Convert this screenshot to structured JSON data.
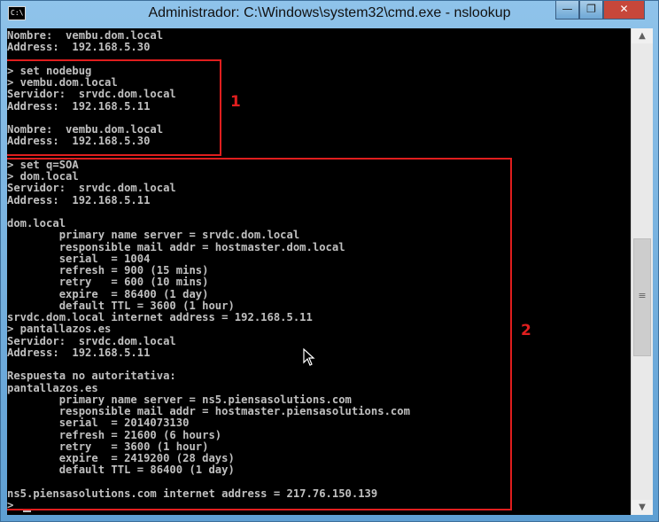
{
  "window": {
    "title": "Administrador: C:\\Windows\\system32\\cmd.exe - nslookup",
    "icon_text": "C:\\",
    "controls": {
      "minimize": "—",
      "maximize": "❐",
      "close": "✕"
    }
  },
  "console": {
    "lines": [
      "Nombre:  vembu.dom.local",
      "Address:  192.168.5.30",
      "",
      "> set nodebug",
      "> vembu.dom.local",
      "Servidor:  srvdc.dom.local",
      "Address:  192.168.5.11",
      "",
      "Nombre:  vembu.dom.local",
      "Address:  192.168.5.30",
      "",
      "> set q=SOA",
      "> dom.local",
      "Servidor:  srvdc.dom.local",
      "Address:  192.168.5.11",
      "",
      "dom.local",
      "        primary name server = srvdc.dom.local",
      "        responsible mail addr = hostmaster.dom.local",
      "        serial  = 1004",
      "        refresh = 900 (15 mins)",
      "        retry   = 600 (10 mins)",
      "        expire  = 86400 (1 day)",
      "        default TTL = 3600 (1 hour)",
      "srvdc.dom.local internet address = 192.168.5.11",
      "> pantallazos.es",
      "Servidor:  srvdc.dom.local",
      "Address:  192.168.5.11",
      "",
      "Respuesta no autoritativa:",
      "pantallazos.es",
      "        primary name server = ns5.piensasolutions.com",
      "        responsible mail addr = hostmaster.piensasolutions.com",
      "        serial  = 2014073130",
      "        refresh = 21600 (6 hours)",
      "        retry   = 3600 (1 hour)",
      "        expire  = 2419200 (28 days)",
      "        default TTL = 86400 (1 day)",
      "",
      "ns5.piensasolutions.com internet address = 217.76.150.139",
      ">"
    ]
  },
  "annotations": {
    "box1_label": "1",
    "box2_label": "2"
  },
  "scrollbar": {
    "up": "▲",
    "down": "▼",
    "grip": "≡"
  },
  "colors": {
    "console_bg": "#000000",
    "console_text": "#c0c0c0",
    "annotation": "#e01e1e"
  }
}
